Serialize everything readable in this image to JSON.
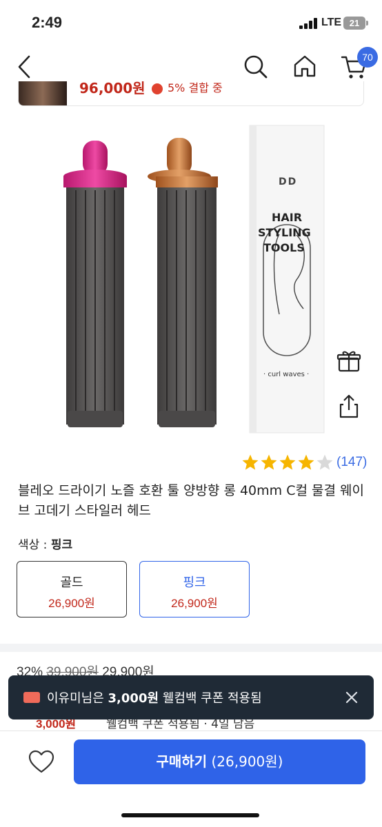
{
  "status_bar": {
    "time": "2:49",
    "network": "LTE",
    "battery": "21"
  },
  "nav": {
    "cart_count": "70",
    "icons": [
      "back-chevron-icon",
      "search-icon",
      "home-icon",
      "cart-icon"
    ]
  },
  "banner": {
    "price": "96,000원",
    "text": "5% 결합 중"
  },
  "product": {
    "box_brand": "DD",
    "box_line1": "HAIR",
    "box_line2": "STYLING",
    "box_line3": "TOOLS",
    "box_tagline": "· curl waves ·",
    "rating": 4,
    "review_count": "(147)",
    "title": "블레오 드라이기 노즐 호환 툴 양방향 롱 40mm C컬 물결 웨이브 고데기 스타일러 헤드"
  },
  "options": {
    "label_prefix": "색상 : ",
    "selected": "핑크",
    "items": [
      {
        "name": "골드",
        "price": "26,900원"
      },
      {
        "name": "핑크",
        "price": "26,900원"
      }
    ]
  },
  "discount": {
    "percent": "32%",
    "original": "39,900원",
    "sale": "29,900원"
  },
  "toast": {
    "prefix": "이유미님은 ",
    "amount": "3,000원",
    "suffix": " 웰컴백 쿠폰 적용됨"
  },
  "coupon_row": {
    "amount": "3,000원",
    "text": "웰컴백 쿠폰 적용됨  ·  4일 남음"
  },
  "bottom": {
    "buy_label": "구매하기",
    "buy_price": "(26,900원)"
  },
  "colors": {
    "accent": "#2f63e8",
    "price_red": "#c1271a",
    "toast_bg": "#1f2a36"
  }
}
